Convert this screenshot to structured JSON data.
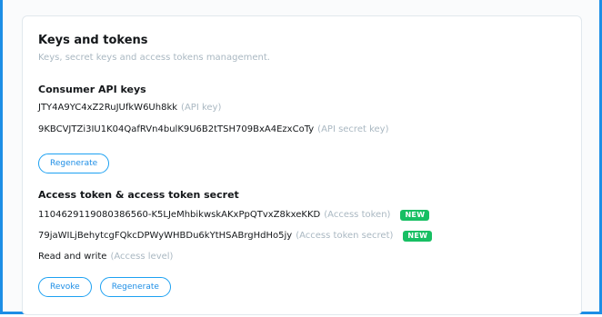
{
  "header": {
    "title": "Keys and tokens",
    "subtitle": "Keys, secret keys and access tokens management."
  },
  "consumer": {
    "title": "Consumer API keys",
    "api_key": "JTY4A9YC4xZ2RuJUfkW6Uh8kk",
    "api_key_label": "(API key)",
    "api_secret": "9KBCVJTZi3IU1K04QafRVn4bulK9U6B2tTSH709BxA4EzxCoTy",
    "api_secret_label": "(API secret key)",
    "regenerate_label": "Regenerate"
  },
  "access": {
    "title": "Access token & access token secret",
    "token": "1104629119080386560-K5LJeMhbikwskAKxPpQTvxZ8kxeKKD",
    "token_label": "(Access token)",
    "token_badge": "NEW",
    "secret": "79jaWILjBehytcgFQkcDPWyWHBDu6kYtHSABrgHdHo5jy",
    "secret_label": "(Access token secret)",
    "secret_badge": "NEW",
    "level": "Read and write",
    "level_label": "(Access level)",
    "revoke_label": "Revoke",
    "regenerate_label": "Regenerate"
  },
  "colors": {
    "accent": "#1da1f2",
    "badge": "#17bf63",
    "muted": "#aab8c2",
    "selection_border": "#1d8ee6"
  }
}
